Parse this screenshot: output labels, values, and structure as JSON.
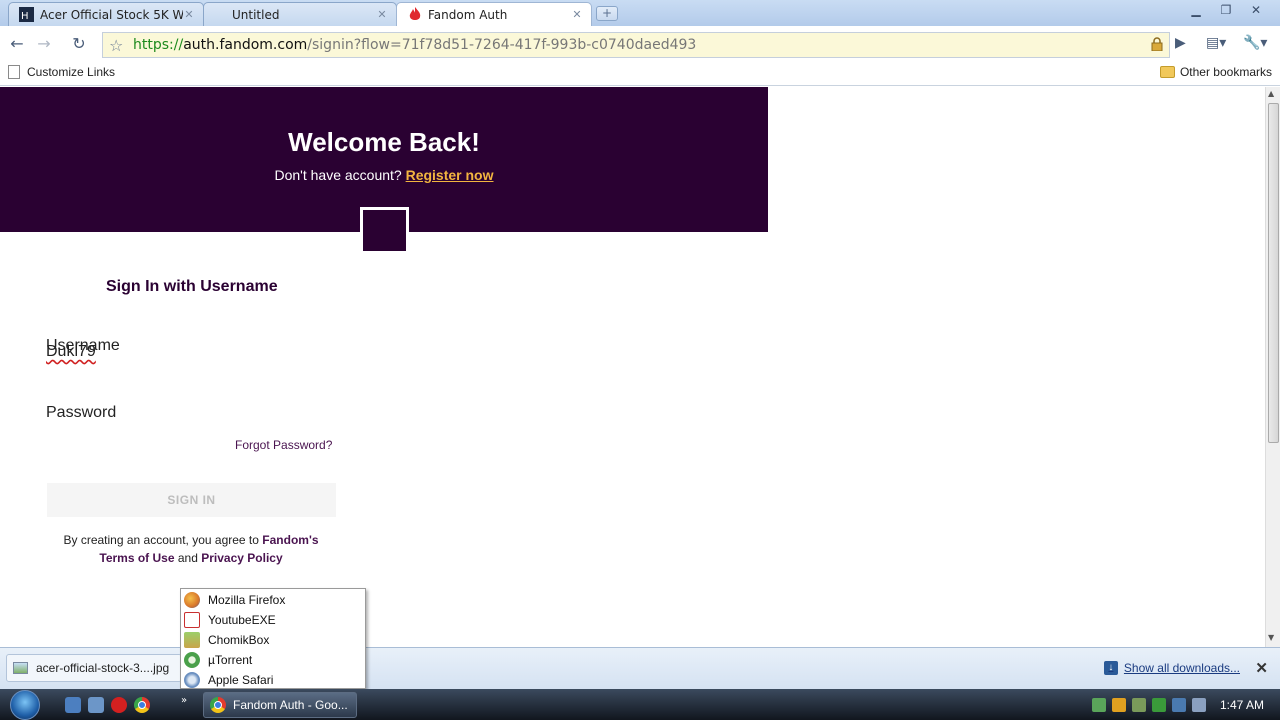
{
  "tabs": [
    {
      "title": "Acer Official Stock 5K Wa..."
    },
    {
      "title": "Untitled"
    },
    {
      "title": "Fandom Auth"
    }
  ],
  "address": {
    "scheme": "https://",
    "host": "auth.fandom.com",
    "path": "/signin?flow=71f78d51-7264-417f-993b-c0740daed493"
  },
  "bookmarks": {
    "left": "Customize Links",
    "right": "Other bookmarks"
  },
  "page": {
    "welcome": "Welcome Back!",
    "no_account": "Don't have account?",
    "register": "Register now",
    "signin_heading": "Sign In with Username",
    "username_label": "Username",
    "username_value": "Dukl79",
    "password_label": "Password",
    "forgot": "Forgot Password?",
    "signin_button": "SIGN IN",
    "terms_pre": "By creating an account, you agree to",
    "terms_brand": "Fandom's",
    "terms_tou": "Terms of Use",
    "terms_and": "and",
    "terms_pp": "Privacy Policy"
  },
  "downloads": {
    "item": "acer-official-stock-3....jpg",
    "show_all": "Show all downloads..."
  },
  "popup": {
    "items": [
      {
        "label": "Mozilla Firefox",
        "color": "#d8762b"
      },
      {
        "label": "YoutubeEXE",
        "color": "#c83030"
      },
      {
        "label": "ChomikBox",
        "color": "#c9a54a"
      },
      {
        "label": "µTorrent",
        "color": "#4aa04a"
      },
      {
        "label": "Apple Safari",
        "color": "#6a8fc0"
      }
    ]
  },
  "taskbar": {
    "task_label": "Fandom Auth - Goo...",
    "clock": "1:47 AM"
  },
  "colors": {
    "brand": "#2a0132",
    "register_link": "#f2b540"
  }
}
